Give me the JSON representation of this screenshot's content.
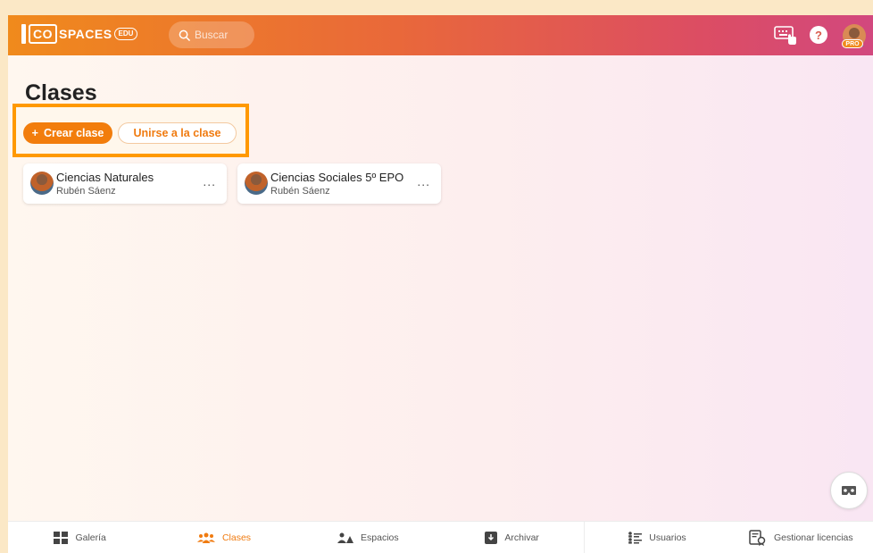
{
  "header": {
    "logo_box": "CO",
    "logo_text": "SPACES",
    "logo_edu": "EDU",
    "search_placeholder": "Buscar",
    "pro_badge": "PRO",
    "help_symbol": "?"
  },
  "page": {
    "title": "Clases",
    "create_button": "Crear clase",
    "create_plus": "+",
    "join_button": "Unirse a la clase"
  },
  "classes": [
    {
      "title": "Ciencias Naturales",
      "owner": "Rubén Sáenz",
      "more": "..."
    },
    {
      "title": "Ciencias Sociales 5º EPO",
      "owner": "Rubén Sáenz",
      "more": "..."
    }
  ],
  "bottom_nav": [
    {
      "label": "Galería",
      "icon": "grid-icon"
    },
    {
      "label": "Clases",
      "icon": "people-icon",
      "active": true
    },
    {
      "label": "Espacios",
      "icon": "spaces-icon"
    },
    {
      "label": "Archivar",
      "icon": "archive-icon"
    },
    {
      "label": "Usuarios",
      "icon": "users-list-icon"
    },
    {
      "label": "Gestionar licencias",
      "icon": "license-icon"
    }
  ],
  "colors": {
    "accent": "#f27d0c",
    "highlight": "#ff9900",
    "header_start": "#f08a1c",
    "header_end": "#d2487e"
  }
}
